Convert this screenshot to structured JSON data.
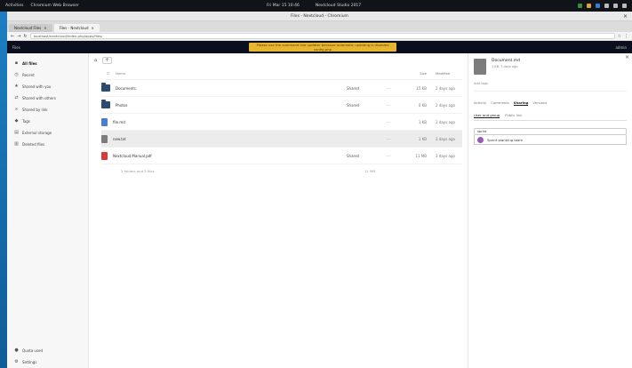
{
  "system_bar": {
    "left_items": [
      "Activities",
      "Chromium Web Browser"
    ],
    "center_items": [
      "Fri Mar 15 10:46",
      "Nextcloud Studio 2017"
    ]
  },
  "window": {
    "title": "Files - Nextcloud - Chromium"
  },
  "tabs": [
    {
      "label": "Nextcloud Files"
    },
    {
      "label": "Files - Nextcloud"
    }
  ],
  "url": "localhost/nextcloud/index.php/apps/files/",
  "header": {
    "app_label": "Files",
    "right_label": "admin",
    "banner_line1": "Please use the command line updater because automatic updating is disabled",
    "banner_line2": "config.php"
  },
  "sidebar": {
    "items": [
      {
        "icon": "folder-icon",
        "label": "All files"
      },
      {
        "icon": "clock-icon",
        "label": "Recent"
      },
      {
        "icon": "star-icon",
        "label": "Shared with you"
      },
      {
        "icon": "share-icon",
        "label": "Shared with others"
      },
      {
        "icon": "link-icon",
        "label": "Shared by link"
      },
      {
        "icon": "tag-icon",
        "label": "Tags"
      },
      {
        "icon": "storage-icon",
        "label": "External storage"
      },
      {
        "icon": "trash-icon",
        "label": "Deleted files"
      }
    ],
    "bottom": [
      {
        "icon": "quota-icon",
        "label": "Quota used"
      },
      {
        "icon": "gear-icon",
        "label": "Settings"
      }
    ]
  },
  "files": {
    "breadcrumb_home": "home",
    "columns": {
      "name": "Name",
      "size": "Size",
      "modified": "Modified"
    },
    "rows": [
      {
        "name": "Documents",
        "type": "folder",
        "share": "Shared",
        "size": "15 KB",
        "modified": "2 days ago",
        "selected": false
      },
      {
        "name": "Photos",
        "type": "folder",
        "share": "Shared",
        "size": "0 KB",
        "modified": "2 days ago",
        "selected": false
      },
      {
        "name": "file.md",
        "type": "text",
        "share": "",
        "size": "1 KB",
        "modified": "3 days ago",
        "selected": false
      },
      {
        "name": "new.txt",
        "type": "text",
        "share": "",
        "size": "1 KB",
        "modified": "3 days ago",
        "selected": true
      },
      {
        "name": "Nextcloud Manual.pdf",
        "type": "pdf",
        "share": "Shared",
        "size": "11 MB",
        "modified": "3 days ago",
        "selected": false
      }
    ],
    "summary": "2 folders and 3 files",
    "summary_size": "11 MB"
  },
  "details": {
    "filename": "Document.md",
    "meta": "1 KB, 3 days ago",
    "tags_placeholder": "Add tags",
    "tabs": [
      "Activity",
      "Comments",
      "Sharing",
      "Versions"
    ],
    "active_tab": "Sharing",
    "subtabs": [
      "User and group",
      "Public link"
    ],
    "search_value": "sprint",
    "result": "Sprint planning team"
  },
  "colors": {
    "accent": "#0082c9",
    "header": "#0b0f1d",
    "banner": "#e8b530",
    "folder": "#2d4a6f",
    "pdf": "#d43b3b",
    "text_file": "#4a7ed6"
  }
}
